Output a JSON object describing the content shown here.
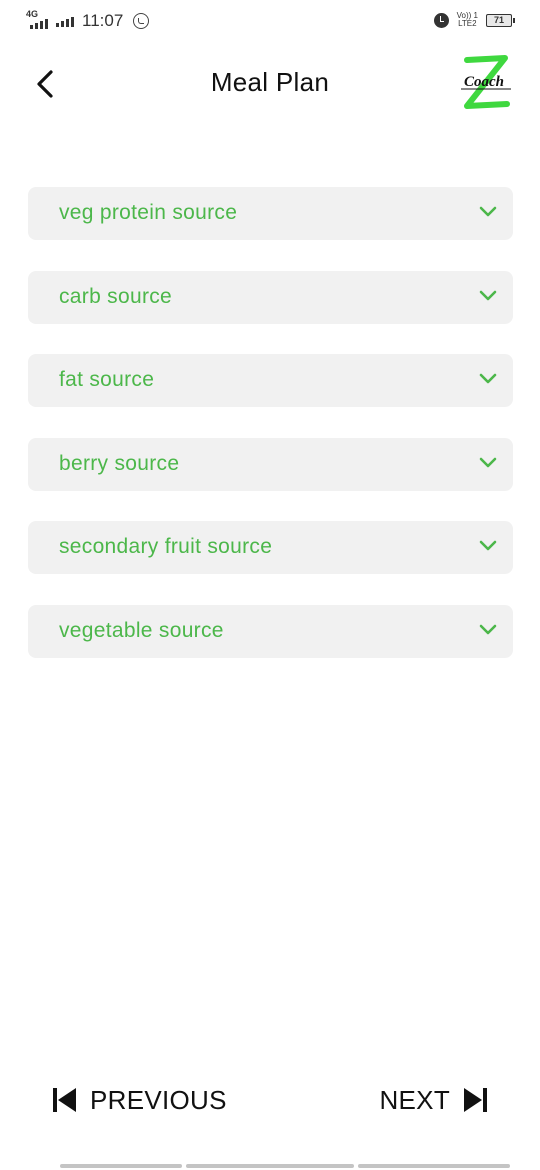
{
  "status_bar": {
    "network": "4G",
    "time": "11:07",
    "volte_line1": "Vo)) 1",
    "volte_line2": "LTE2",
    "battery": "71"
  },
  "header": {
    "title": "Meal Plan",
    "logo_text": "Coach"
  },
  "dropdowns": [
    {
      "label": "veg protein source"
    },
    {
      "label": "carb source"
    },
    {
      "label": "fat source"
    },
    {
      "label": "berry source"
    },
    {
      "label": "secondary fruit source"
    },
    {
      "label": "vegetable source"
    }
  ],
  "footer": {
    "previous_label": "PREVIOUS",
    "next_label": "NEXT"
  },
  "colors": {
    "accent_green": "#4cb74a",
    "dropdown_bg": "#f1f1f1",
    "text_dark": "#111111"
  },
  "icons": {
    "back": "chevron-left-icon",
    "dropdown": "chevron-down-icon",
    "previous": "skip-previous-icon",
    "next": "skip-next-icon"
  }
}
